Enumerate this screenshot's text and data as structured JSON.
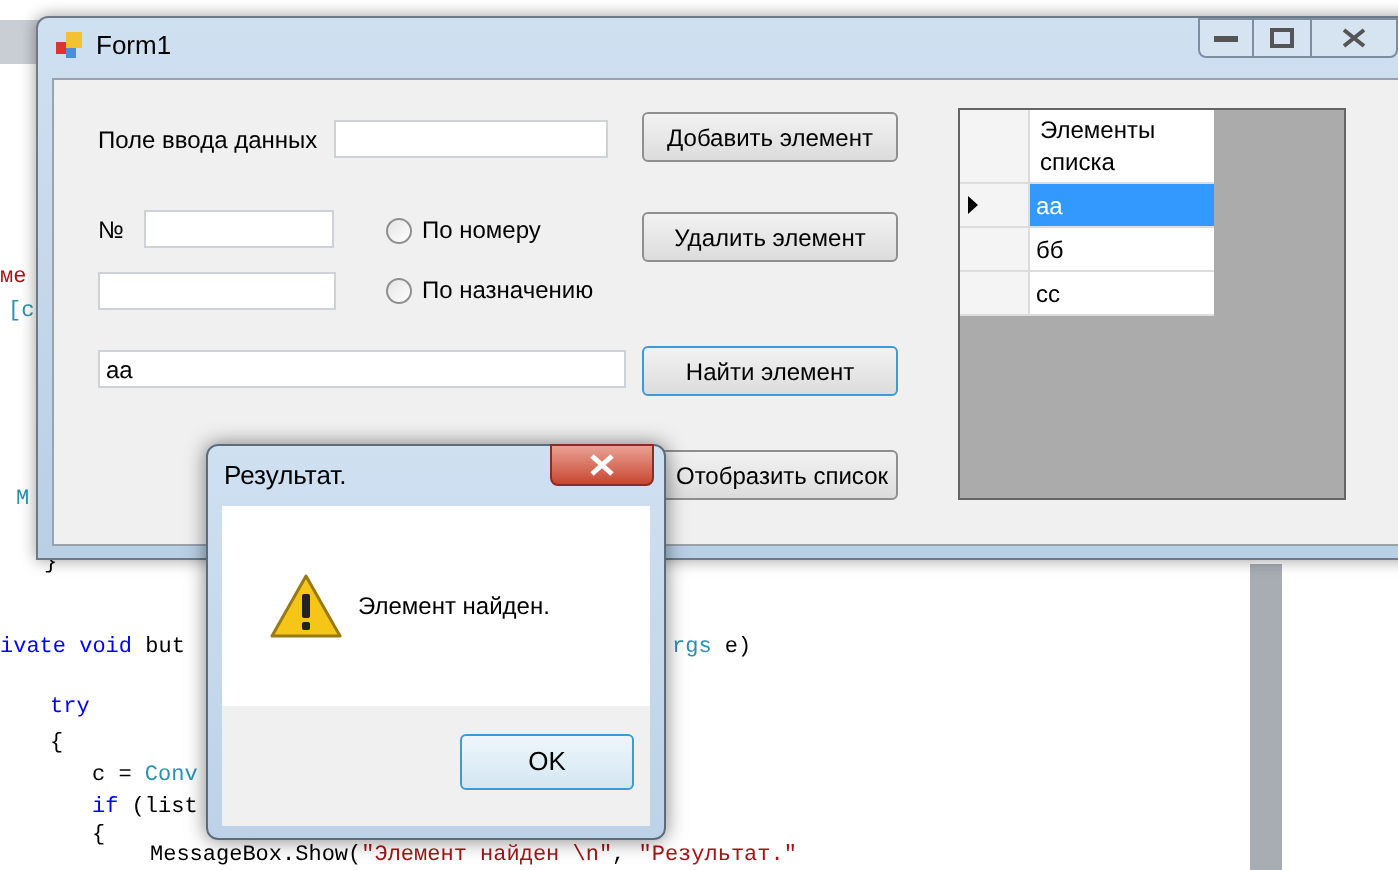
{
  "code_lines": [
    {
      "segments": [
        {
          "text": "ме",
          "kind": "string"
        }
      ]
    },
    {
      "segments": [
        {
          "text": "[c",
          "kind": "type"
        }
      ]
    },
    {
      "segments": [
        {
          "text": "M",
          "kind": "type"
        }
      ]
    },
    {
      "segments": [
        {
          "text": "}",
          "kind": "plain"
        }
      ]
    },
    {
      "segments": [
        {
          "text": "ivate void",
          "kind": "keyword"
        },
        {
          "text": " but",
          "kind": "plain"
        }
      ]
    },
    {
      "segments": [
        {
          "text": "rgs",
          "kind": "type"
        },
        {
          "text": " e)",
          "kind": "plain"
        }
      ]
    },
    {
      "segments": [
        {
          "text": "try",
          "kind": "keyword"
        }
      ]
    },
    {
      "segments": [
        {
          "text": "{",
          "kind": "plain"
        }
      ]
    },
    {
      "segments": [
        {
          "text": "c = ",
          "kind": "plain"
        },
        {
          "text": "Conv",
          "kind": "type"
        }
      ]
    },
    {
      "segments": [
        {
          "text": "if",
          "kind": "keyword"
        },
        {
          "text": " (list",
          "kind": "plain"
        }
      ]
    },
    {
      "segments": [
        {
          "text": "{",
          "kind": "plain"
        }
      ]
    },
    {
      "segments": [
        {
          "text": "MessageBox.Show(",
          "kind": "plain"
        },
        {
          "text": "\"Элемент найден \\n\"",
          "kind": "string"
        },
        {
          "text": ", ",
          "kind": "plain"
        },
        {
          "text": "\"Результат.\"",
          "kind": "string"
        }
      ]
    }
  ],
  "window": {
    "title": "Form1"
  },
  "form": {
    "data_label": "Поле ввода данных",
    "add_button": "Добавить элемент",
    "number_label": "№",
    "radios": [
      {
        "label": "По номеру",
        "selected": false
      },
      {
        "label": "По назначению",
        "selected": false
      }
    ],
    "delete_button": "Удалить элемент",
    "search_field": {
      "value": "аа"
    },
    "find_button": {
      "label": "Найти элемент",
      "focused": true
    },
    "show_button": "Отобразить список",
    "grid": {
      "column": "Элементы списка",
      "rows": [
        {
          "value": "аа",
          "selected": true
        },
        {
          "value": "бб",
          "selected": false
        },
        {
          "value": "cc",
          "selected": false
        }
      ]
    }
  },
  "dialog": {
    "title": "Результат.",
    "message": "Элемент найден.",
    "button": "OK"
  }
}
